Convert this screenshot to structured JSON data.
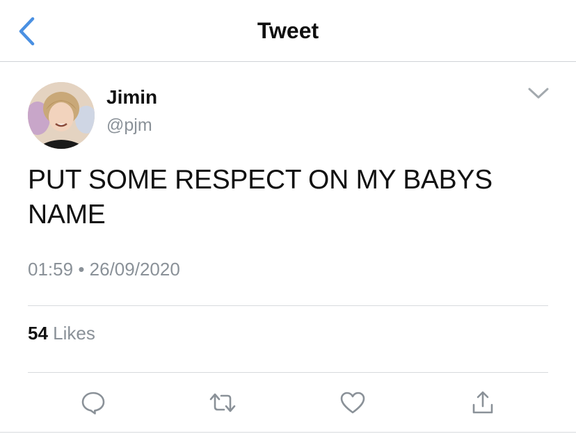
{
  "header": {
    "title": "Tweet",
    "back_icon": "chevron-left-icon",
    "accent_color": "#4a90e2"
  },
  "tweet": {
    "author": {
      "display_name": "Jimin",
      "handle": "@pjm",
      "avatar_icon": "user-avatar"
    },
    "text_line1": "PUT SOME RESPECT ON MY BABYS",
    "text_line2": "NAME",
    "time": "01:59",
    "separator": "•",
    "date": "26/09/2020",
    "more_icon": "chevron-down-icon"
  },
  "stats": {
    "likes_count": "54",
    "likes_label": "Likes"
  },
  "actions": [
    {
      "name": "reply",
      "icon": "reply-icon"
    },
    {
      "name": "retweet",
      "icon": "retweet-icon"
    },
    {
      "name": "like",
      "icon": "heart-icon"
    },
    {
      "name": "share",
      "icon": "share-icon"
    }
  ],
  "colors": {
    "icon_gray": "#8a9198",
    "divider": "#d7dadd"
  }
}
